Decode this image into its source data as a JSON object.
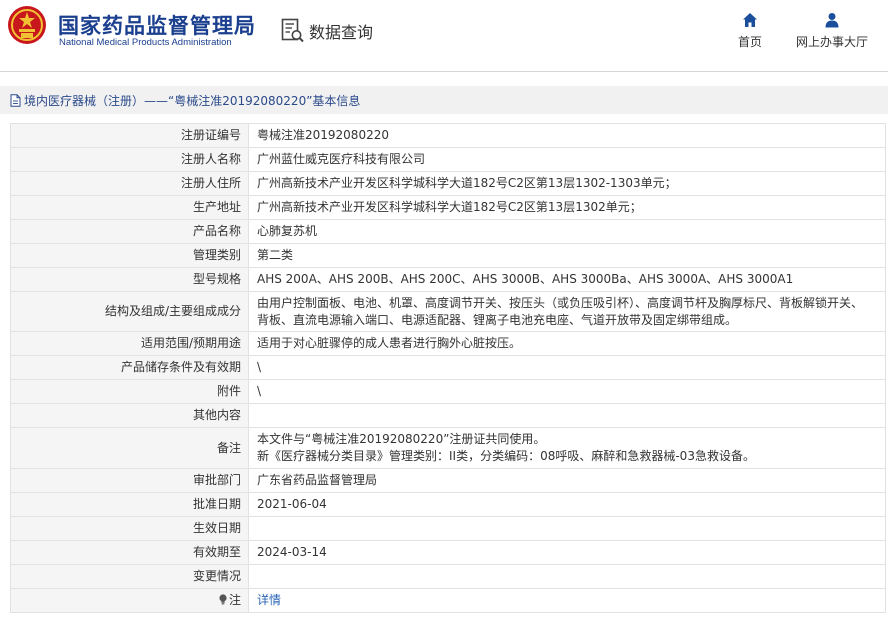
{
  "header": {
    "logo_cn": "国家药品监督管理局",
    "logo_en": "National Medical Products Administration",
    "logo_icon": "national-emblem-icon",
    "query_title": "数据查询",
    "query_icon": "document-search-icon",
    "nav": [
      {
        "label": "首页",
        "icon": "home-icon"
      },
      {
        "label": "网上办事大厅",
        "icon": "user-icon"
      }
    ]
  },
  "breadcrumb": {
    "icon": "document-icon",
    "text": "境内医疗器械（注册）——“粤械注准20192080220”基本信息"
  },
  "record": {
    "registration_no": {
      "label": "注册证编号",
      "value": "粤械注准20192080220"
    },
    "registrant_name": {
      "label": "注册人名称",
      "value": "广州蓝仕威克医疗科技有限公司"
    },
    "registrant_address": {
      "label": "注册人住所",
      "value": "广州高新技术产业开发区科学城科学大道182号C2区第13层1302-1303单元；"
    },
    "production_address": {
      "label": "生产地址",
      "value": "广州高新技术产业开发区科学城科学大道182号C2区第13层1302单元；"
    },
    "product_name": {
      "label": "产品名称",
      "value": "心肺复苏机"
    },
    "management_class": {
      "label": "管理类别",
      "value": "第二类"
    },
    "model_spec": {
      "label": "型号规格",
      "value": "AHS 200A、AHS 200B、AHS 200C、AHS 3000B、AHS 3000Ba、AHS 3000A、AHS 3000A1"
    },
    "structure": {
      "label": "结构及组成/主要组成成分",
      "line1": "由用户控制面板、电池、机罩、高度调节开关、按压头（或负压吸引杯）、高度调节杆及胸厚标尺、背板解锁开关、",
      "line2": "背板、直流电源输入端口、电源适配器、锂离子电池充电座、气道开放带及固定绑带组成。"
    },
    "intended_use": {
      "label": "适用范围/预期用途",
      "value": "适用于对心脏骤停的成人患者进行胸外心脏按压。"
    },
    "storage": {
      "label": "产品储存条件及有效期",
      "value": "\\"
    },
    "attachment": {
      "label": "附件",
      "value": "\\"
    },
    "other": {
      "label": "其他内容",
      "value": ""
    },
    "remarks": {
      "label": "备注",
      "line1": "本文件与“粤械注准20192080220”注册证共同使用。",
      "line2": "新《医疗器械分类目录》管理类别：II类，分类编码：08呼吸、麻醉和急救器械-03急救设备。"
    },
    "approval_dept": {
      "label": "审批部门",
      "value": "广东省药品监督管理局"
    },
    "approval_date": {
      "label": "批准日期",
      "value": "2021-06-04"
    },
    "effective_date": {
      "label": "生效日期",
      "value": ""
    },
    "valid_until": {
      "label": "有效期至",
      "value": "2024-03-14"
    },
    "changes": {
      "label": "变更情况",
      "value": ""
    },
    "note": {
      "label": "注",
      "icon": "lightbulb-icon",
      "link": "详情"
    }
  },
  "colors": {
    "brand_blue": "#1b3f8f",
    "link_blue": "#2b66b5",
    "label_bg": "#f5f5f5",
    "breadcrumb_bg": "#f1f1f1"
  }
}
